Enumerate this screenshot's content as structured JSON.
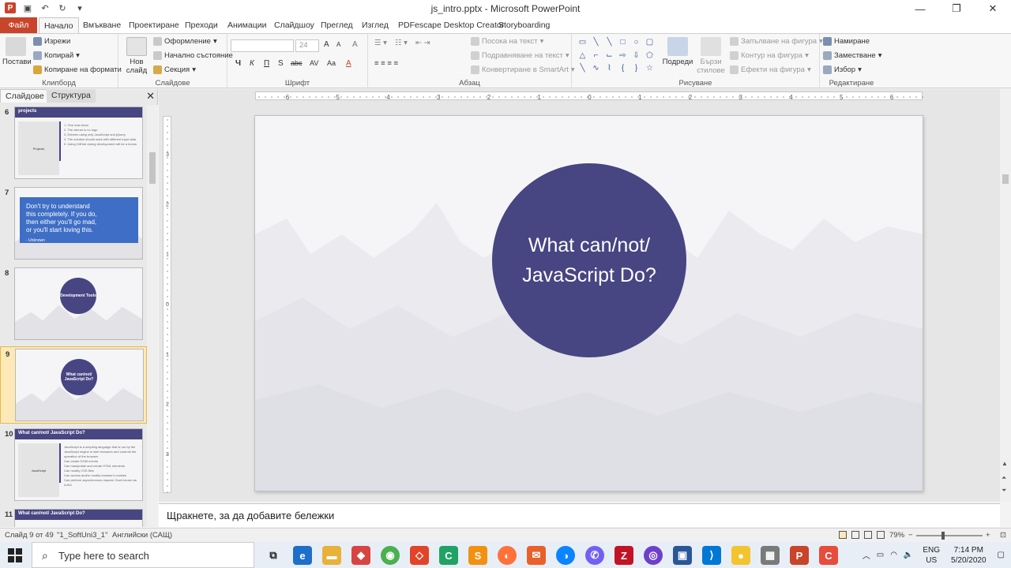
{
  "window": {
    "title": "js_intro.pptx  -  Microsoft PowerPoint",
    "minimize": "—",
    "maximize": "❐",
    "close": "✕"
  },
  "tabs": [
    {
      "label": "Файл"
    },
    {
      "label": "Начало"
    },
    {
      "label": "Вмъкване"
    },
    {
      "label": "Проектиране"
    },
    {
      "label": "Преходи"
    },
    {
      "label": "Анимации"
    },
    {
      "label": "Слайдшоу"
    },
    {
      "label": "Преглед"
    },
    {
      "label": "Изглед"
    },
    {
      "label": "PDFescape Desktop Creator"
    },
    {
      "label": "Storyboarding"
    }
  ],
  "ribbon": {
    "clipboard": {
      "label": "Клипборд",
      "paste": "Постави",
      "cut": "Изрежи",
      "copy": "Копирай",
      "format_painter": "Копиране на формати"
    },
    "slides": {
      "label": "Слайдове",
      "new_slide": "Нов",
      "new_slide2": "слайд",
      "layout": "Оформление",
      "reset": "Начално състояние",
      "section": "Секция"
    },
    "font": {
      "label": "Шрифт",
      "size": "24",
      "bold": "Ч",
      "italic": "К",
      "underline": "П",
      "strike": "S",
      "abc": "abc",
      "av": "AV",
      "aa": "Aa",
      "grow": "A",
      "shrink": "A",
      "clear": "A"
    },
    "paragraph": {
      "label": "Абзац",
      "text_direction": "Посока на текст",
      "align_text": "Подравняване на текст",
      "smartart": "Конвертиране в SmartArt"
    },
    "drawing": {
      "label": "Рисуване",
      "arrange": "Подреди",
      "quick_styles": "Бързи",
      "quick_styles2": "стилове",
      "shape_fill": "Запълване на фигура",
      "shape_outline": "Контур на фигура",
      "shape_effects": "Ефекти на фигура"
    },
    "editing": {
      "label": "Редактиране",
      "find": "Намиране",
      "replace": "Заместване",
      "select": "Избор"
    }
  },
  "panel": {
    "tab_slides": "Слайдове",
    "tab_outline": "Структура",
    "close": "✕",
    "slides": [
      {
        "number": "6",
        "title": "projects",
        "left_label": "Projects",
        "bullets": [
          "1. One man team",
          "2. The winner is no logo",
          "3. Entrees using only JavaScript and jQuery",
          "4. The solution should work with different input data",
          "5. Using GitHub during development will be a bonus"
        ]
      },
      {
        "number": "7",
        "quote_l1": "Don't try to understand",
        "quote_l2": "this completely. If you do,",
        "quote_l3": "then either you'll go mad,",
        "quote_l4": "or you'll start loving this.",
        "author": "- Unknown"
      },
      {
        "number": "8",
        "circle": "Development Tools"
      },
      {
        "number": "9",
        "circle": "What can/not/ JavaScript Do?"
      },
      {
        "number": "10",
        "title": "What can/not/ JavaScript Do?",
        "left_label": "JavaScript",
        "bullets": [
          "JavaScript is a scripting language that is run by the JavaScript engine in web browsers and controls the operation of the browser",
          "Can create DOM events",
          "Can manipulate and create HTML elements",
          "Can modify CSS files",
          "Can access and/or modify browser's cookies",
          "Can perform asynchronous request. Such known as AJAX"
        ]
      },
      {
        "number": "11",
        "title": "What can/not/ JavaScript Do?"
      }
    ]
  },
  "slide": {
    "title_l1": "What can/not/",
    "title_l2": "JavaScript Do?",
    "circle_color": "#474582"
  },
  "ruler": {
    "h": [
      "6",
      "5",
      "4",
      "3",
      "2",
      "1",
      "0",
      "1",
      "2",
      "3",
      "4",
      "5",
      "6"
    ],
    "v": [
      "3",
      "2",
      "1",
      "0",
      "1",
      "2",
      "3"
    ]
  },
  "notes": {
    "placeholder": "Щракнете, за да добавите бележки"
  },
  "status": {
    "slide": "Слайд 9 от 49",
    "theme": "\"1_SoftUni3_1\"",
    "language": "Английски (САЩ)",
    "zoom": "79%",
    "zoom_minus": "−",
    "zoom_plus": "+"
  },
  "taskbar": {
    "search_placeholder": "Type here to search",
    "lang1": "ENG",
    "lang2": "US",
    "time": "7:14 PM",
    "date": "5/20/2020"
  },
  "colors": {
    "accent": "#c8442b",
    "slide_purple": "#474582",
    "slide_blue": "#3e6ec5"
  }
}
